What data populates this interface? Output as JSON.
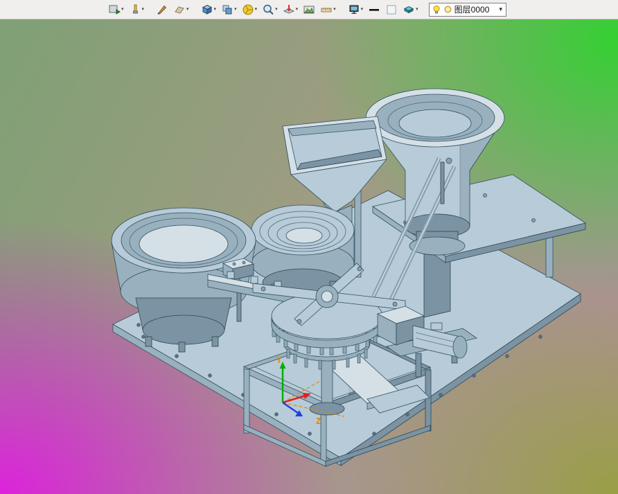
{
  "toolbar": {
    "icons": [
      {
        "name": "capture-output",
        "dropdown": true
      },
      {
        "name": "light-settings",
        "dropdown": true
      },
      {
        "name": "edit-appearance",
        "dropdown": false
      },
      {
        "name": "material-swatch",
        "dropdown": true
      },
      {
        "name": "view-orientation-cube",
        "dropdown": true
      },
      {
        "name": "display-style",
        "dropdown": true
      },
      {
        "name": "render-appearance",
        "dropdown": true
      },
      {
        "name": "zoom-tools",
        "dropdown": true
      },
      {
        "name": "section-view",
        "dropdown": true
      },
      {
        "name": "scene-background",
        "dropdown": false
      },
      {
        "name": "grid-settings",
        "dropdown": true
      },
      {
        "name": "screen-display",
        "dropdown": true
      },
      {
        "name": "line-weight",
        "dropdown": false
      },
      {
        "name": "blank-frame",
        "dropdown": false
      },
      {
        "name": "shaded-display",
        "dropdown": true
      }
    ],
    "layer_selector": {
      "value": "图层0000"
    }
  },
  "viewport": {
    "background_colors": {
      "top_left": "#7fa075",
      "top_right": "#2ed32e",
      "bottom_left": "#e01ce0",
      "bottom_right": "#96a13d"
    },
    "model_colors": {
      "part": "#b7cbd8",
      "shade": "#99b0bf",
      "dark": "#7b93a2",
      "light": "#d4dfe6",
      "edge": "#31505f"
    },
    "triad": {
      "y_label": "Y",
      "z_label": "Z",
      "x_axis_color": "#e02020",
      "y_axis_color": "#00b000",
      "z_axis_color": "#2040e0",
      "label_color": "#e08a00"
    }
  }
}
